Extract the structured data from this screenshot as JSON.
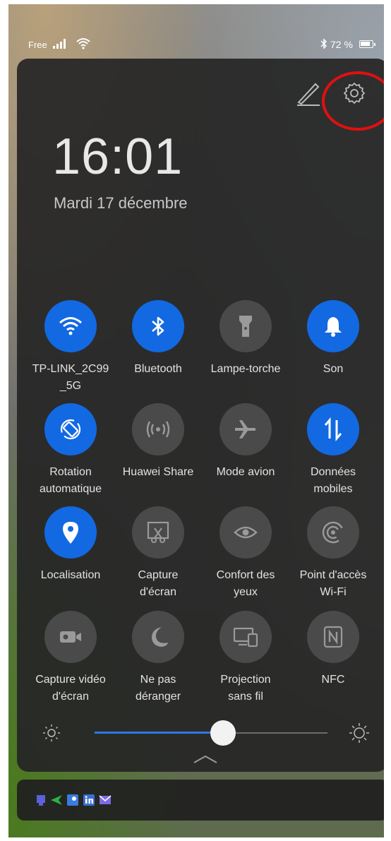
{
  "status_bar": {
    "carrier": "Free",
    "battery": "72 %"
  },
  "clock": {
    "time": "16:01",
    "date": "Mardi 17 décembre"
  },
  "tiles": [
    {
      "label": "TP-LINK_2C99\n_5G",
      "icon": "wifi-icon",
      "on": true
    },
    {
      "label": "Bluetooth",
      "icon": "bluetooth-icon",
      "on": true
    },
    {
      "label": "Lampe-torche",
      "icon": "flashlight-icon",
      "on": false
    },
    {
      "label": "Son",
      "icon": "bell-icon",
      "on": true
    },
    {
      "label": "Rotation\nautomatique",
      "icon": "rotation-icon",
      "on": true
    },
    {
      "label": "Huawei Share",
      "icon": "share-icon",
      "on": false
    },
    {
      "label": "Mode avion",
      "icon": "airplane-icon",
      "on": false
    },
    {
      "label": "Données\nmobiles",
      "icon": "mobile-data-icon",
      "on": true
    },
    {
      "label": "Localisation",
      "icon": "location-icon",
      "on": true
    },
    {
      "label": "Capture\nd'écran",
      "icon": "screenshot-icon",
      "on": false
    },
    {
      "label": "Confort des\nyeux",
      "icon": "eye-icon",
      "on": false
    },
    {
      "label": "Point d'accès\nWi-Fi",
      "icon": "hotspot-icon",
      "on": false
    },
    {
      "label": "Capture vidéo\nd'écran",
      "icon": "screen-record-icon",
      "on": false
    },
    {
      "label": "Ne pas\ndéranger",
      "icon": "moon-icon",
      "on": false
    },
    {
      "label": "Projection\nsans fil",
      "icon": "projection-icon",
      "on": false
    },
    {
      "label": "NFC",
      "icon": "nfc-icon",
      "on": false
    }
  ],
  "brightness": {
    "level": 0.55
  },
  "colors": {
    "accent": "#1269e2",
    "tile_off": "#4a4a4a",
    "annotation": "#e01010"
  }
}
